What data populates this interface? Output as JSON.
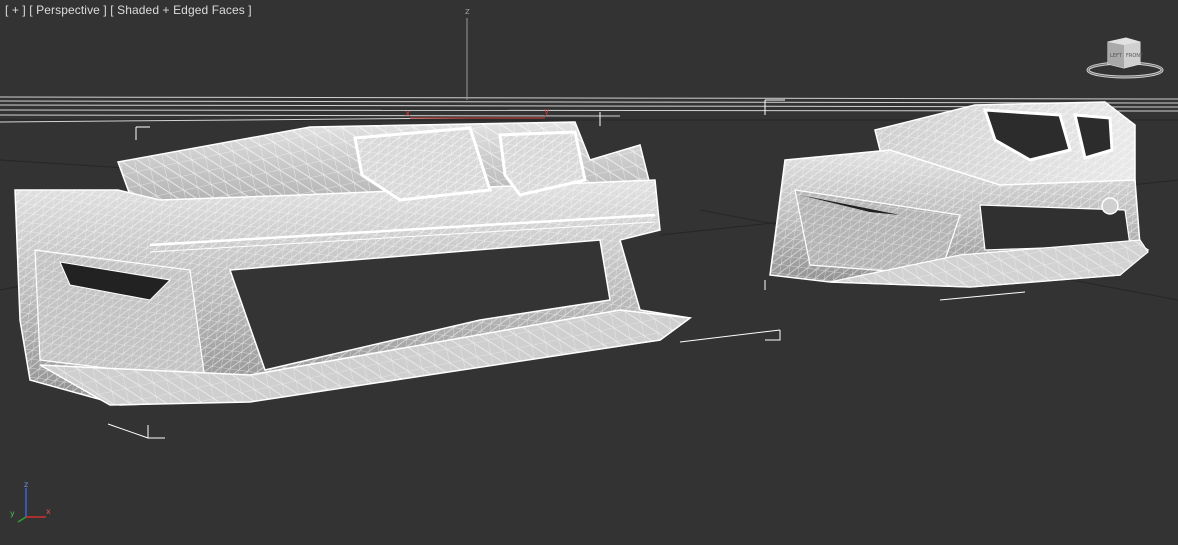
{
  "viewport": {
    "menu_label": "[ + ]",
    "view_label": "[ Perspective ]",
    "shading_label": "[ Shaded + Edged Faces ]"
  },
  "viewcube": {
    "face_left": "LEFT",
    "face_front": "FRONT"
  },
  "gizmo": {
    "z_label": "z",
    "x_label": "x",
    "y_label": "y"
  },
  "axis_tripod": {
    "z_label": "z",
    "y_label": "y",
    "x_label": "x"
  },
  "colors": {
    "background": "#333333",
    "grid": "#1f1f1f",
    "horizon_lines": "#d8d8d8",
    "mesh_fill": "#bfbfbf",
    "wire": "#ffffff",
    "axis_x": "#d12e2e",
    "axis_y": "#2fa12f",
    "axis_z": "#3b64d6"
  },
  "icons": {
    "viewcube": "viewcube-icon",
    "axis_tripod": "axis-tripod-icon"
  }
}
